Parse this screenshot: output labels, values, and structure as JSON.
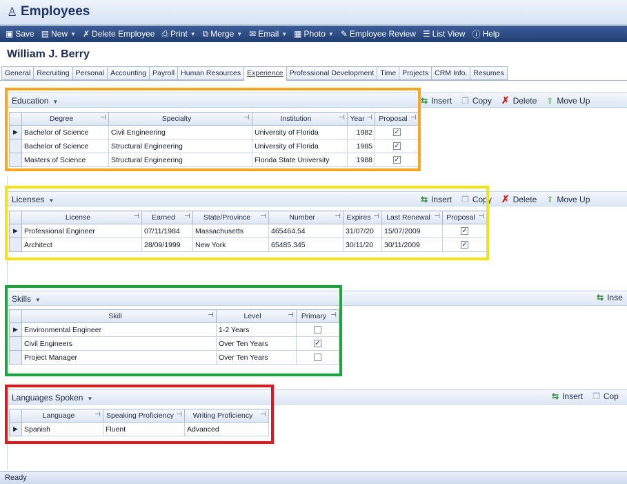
{
  "window": {
    "title": "Employees"
  },
  "toolbar": [
    {
      "label": "Save",
      "icon": "save-icon",
      "glyph": "▣",
      "dropdown": false
    },
    {
      "label": "New",
      "icon": "new-icon",
      "glyph": "▤",
      "dropdown": true
    },
    {
      "label": "Delete Employee",
      "icon": "delete-icon",
      "glyph": "✗",
      "dropdown": false
    },
    {
      "label": "Print",
      "icon": "print-icon",
      "glyph": "⎙",
      "dropdown": true
    },
    {
      "label": "Merge",
      "icon": "merge-icon",
      "glyph": "⧉",
      "dropdown": true
    },
    {
      "label": "Email",
      "icon": "email-icon",
      "glyph": "✉",
      "dropdown": true
    },
    {
      "label": "Photo",
      "icon": "photo-icon",
      "glyph": "▦",
      "dropdown": true
    },
    {
      "label": "Employee Review",
      "icon": "review-icon",
      "glyph": "✎",
      "dropdown": false
    },
    {
      "label": "List View",
      "icon": "list-view-icon",
      "glyph": "☰",
      "dropdown": false
    },
    {
      "label": "Help",
      "icon": "help-icon",
      "glyph": "ⓘ",
      "dropdown": false
    }
  ],
  "employee_name": "William J. Berry",
  "tabs": [
    "General",
    "Recruiting",
    "Personal",
    "Accounting",
    "Payroll",
    "Human Resources",
    "Experience",
    "Professional Development",
    "Time",
    "Projects",
    "CRM Info.",
    "Resumes"
  ],
  "active_tab": "Experience",
  "section_actions": {
    "insert": "Insert",
    "copy": "Copy",
    "delete": "Delete",
    "move_up": "Move Up"
  },
  "education": {
    "title": "Education",
    "columns": [
      "Degree",
      "Specialty",
      "Institution",
      "Year",
      "Proposal"
    ],
    "rows": [
      {
        "degree": "Bachelor of Science",
        "specialty": "Civil Engineering",
        "institution": "University of Florida",
        "year": "1982",
        "proposal": true
      },
      {
        "degree": "Bachelor of Science",
        "specialty": "Structural Engineering",
        "institution": "University of Florida",
        "year": "1985",
        "proposal": true
      },
      {
        "degree": "Masters of Science",
        "specialty": "Structural Engineering",
        "institution": "Florida State University",
        "year": "1988",
        "proposal": true
      }
    ]
  },
  "licenses": {
    "title": "Licenses",
    "columns": [
      "License",
      "Earned",
      "State/Province",
      "Number",
      "Expires",
      "Last Renewal",
      "Proposal"
    ],
    "rows": [
      {
        "license": "Professional Engineer",
        "earned": "07/11/1984",
        "state": "Massachusetts",
        "number": "465464.54",
        "expires": "31/07/20",
        "renewal": "15/07/2009",
        "proposal": true
      },
      {
        "license": "Architect",
        "earned": "28/09/1999",
        "state": "New York",
        "number": "65485.345",
        "expires": "30/11/20",
        "renewal": "30/11/2009",
        "proposal": true
      }
    ]
  },
  "skills": {
    "title": "Skills",
    "insert_label": "Inse",
    "columns": [
      "Skill",
      "Level",
      "Primary"
    ],
    "rows": [
      {
        "skill": "Environmental Engineer",
        "level": "1-2 Years",
        "primary": false
      },
      {
        "skill": "Civil Engineers",
        "level": "Over Ten Years",
        "primary": true
      },
      {
        "skill": "Project Manager",
        "level": "Over Ten Years",
        "primary": false
      }
    ]
  },
  "languages": {
    "title": "Languages Spoken",
    "insert_label": "Insert",
    "copy_label": "Cop",
    "columns": [
      "Language",
      "Speaking Proficiency",
      "Writing Proficiency"
    ],
    "rows": [
      {
        "language": "Spanish",
        "speaking": "Fluent",
        "writing": "Advanced"
      }
    ]
  },
  "highlight_colors": {
    "education": "#f5a623",
    "licenses": "#f2e21a",
    "skills": "#15a83a",
    "languages": "#e0181e"
  },
  "status": "Ready"
}
